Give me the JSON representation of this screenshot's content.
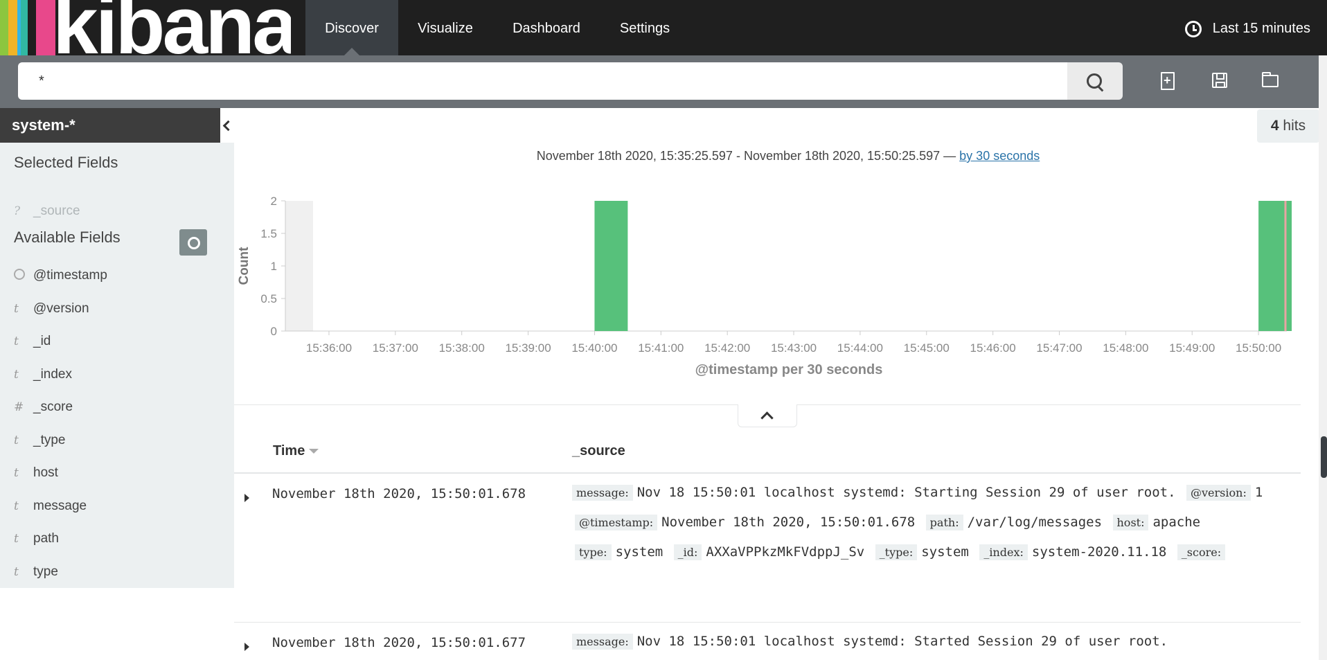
{
  "app": {
    "logo_text": "kibana",
    "logo_colors": [
      "#8cc63f",
      "#f0b429",
      "#33b5e5",
      "#e8488b"
    ]
  },
  "nav": {
    "items": [
      {
        "label": "Discover",
        "active": true
      },
      {
        "label": "Visualize",
        "active": false
      },
      {
        "label": "Dashboard",
        "active": false
      },
      {
        "label": "Settings",
        "active": false
      }
    ],
    "time_range_label": "Last 15 minutes"
  },
  "search": {
    "query": "*"
  },
  "sidebar": {
    "index_pattern": "system-*",
    "selected_fields_title": "Selected Fields",
    "selected_fields": [
      {
        "type": "?",
        "name": "_source"
      }
    ],
    "available_fields_title": "Available Fields",
    "available_fields": [
      {
        "type": "clock",
        "name": "@timestamp"
      },
      {
        "type": "t",
        "name": "@version"
      },
      {
        "type": "t",
        "name": "_id"
      },
      {
        "type": "t",
        "name": "_index"
      },
      {
        "type": "#",
        "name": "_score"
      },
      {
        "type": "t",
        "name": "_type"
      },
      {
        "type": "t",
        "name": "host"
      },
      {
        "type": "t",
        "name": "message"
      },
      {
        "type": "t",
        "name": "path"
      },
      {
        "type": "t",
        "name": "type"
      }
    ]
  },
  "results": {
    "hits_count": "4",
    "hits_label": "hits",
    "range_text": "November 18th 2020, 15:35:25.597 - November 18th 2020, 15:50:25.597 —",
    "interval_link": "by 30 seconds"
  },
  "chart_data": {
    "type": "bar",
    "ylabel": "Count",
    "xlabel": "@timestamp per 30 seconds",
    "yticks": [
      "0",
      "0.5",
      "1",
      "1.5",
      "2"
    ],
    "xticks": [
      "15:36:00",
      "15:37:00",
      "15:38:00",
      "15:39:00",
      "15:40:00",
      "15:41:00",
      "15:42:00",
      "15:43:00",
      "15:44:00",
      "15:45:00",
      "15:46:00",
      "15:47:00",
      "15:48:00",
      "15:49:00",
      "15:50:00"
    ],
    "ylim": [
      0,
      2
    ],
    "xlim": [
      "15:35:25.597",
      "15:50:25.597"
    ],
    "bars": [
      {
        "x": "15:40:00",
        "value": 2
      },
      {
        "x": "15:50:00",
        "value": 2
      }
    ],
    "bar_color": "#57c17b"
  },
  "table": {
    "headers": {
      "time": "Time",
      "source": "_source"
    },
    "rows": [
      {
        "time": "November 18th 2020, 15:50:01.678",
        "fields": [
          {
            "k": "message:",
            "v": "Nov 18 15:50:01 localhost systemd: Starting Session 29 of user root."
          },
          {
            "k": "@version:",
            "v": "1"
          },
          {
            "k": "@timestamp:",
            "v": "November 18th 2020, 15:50:01.678"
          },
          {
            "k": "path:",
            "v": "/var/log/messages"
          },
          {
            "k": "host:",
            "v": "apache"
          },
          {
            "k": "type:",
            "v": "system"
          },
          {
            "k": "_id:",
            "v": "AXXaVPPkzMkFVdppJ_Sv"
          },
          {
            "k": "_type:",
            "v": "system"
          },
          {
            "k": "_index:",
            "v": "system-2020.11.18"
          },
          {
            "k": "_score:",
            "v": ""
          }
        ]
      },
      {
        "time": "November 18th 2020, 15:50:01.677",
        "fields": [
          {
            "k": "message:",
            "v": "Nov 18 15:50:01 localhost systemd: Started Session 29 of user root."
          }
        ]
      }
    ]
  }
}
